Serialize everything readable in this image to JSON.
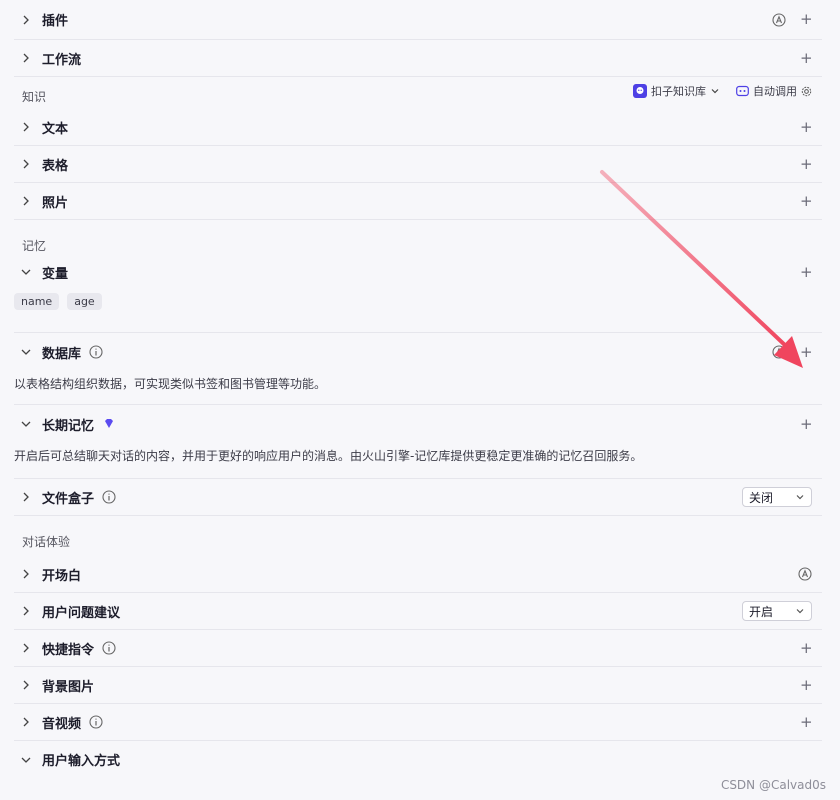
{
  "skills": {
    "plugins": {
      "title": "插件"
    },
    "workflow": {
      "title": "工作流"
    }
  },
  "knowledge": {
    "label": "知识",
    "kb_selector": "扣子知识库",
    "auto_call": "自动调用",
    "items": [
      "文本",
      "表格",
      "照片"
    ]
  },
  "memory": {
    "label": "记忆",
    "variables": {
      "title": "变量",
      "tags": [
        "name",
        "age"
      ]
    },
    "database": {
      "title": "数据库",
      "desc": "以表格结构组织数据，可实现类似书签和图书管理等功能。"
    },
    "long_term": {
      "title": "长期记忆",
      "desc": "开启后可总结聊天对话的内容，并用于更好的响应用户的消息。由火山引擎-记忆库提供更稳定更准确的记忆召回服务。"
    },
    "file_box": {
      "title": "文件盒子",
      "value": "关闭"
    }
  },
  "dialog": {
    "label": "对话体验",
    "opening": {
      "title": "开场白"
    },
    "suggestions": {
      "title": "用户问题建议",
      "value": "开启"
    },
    "shortcuts": {
      "title": "快捷指令"
    },
    "background": {
      "title": "背景图片"
    },
    "av": {
      "title": "音视频"
    },
    "input_mode": {
      "title": "用户输入方式"
    }
  },
  "plus": "+",
  "watermark": "CSDN @Calvad0s",
  "colors": {
    "accent": "#4e40e5",
    "arrow": "#f0455e",
    "diamond": "#5b4bf0"
  }
}
